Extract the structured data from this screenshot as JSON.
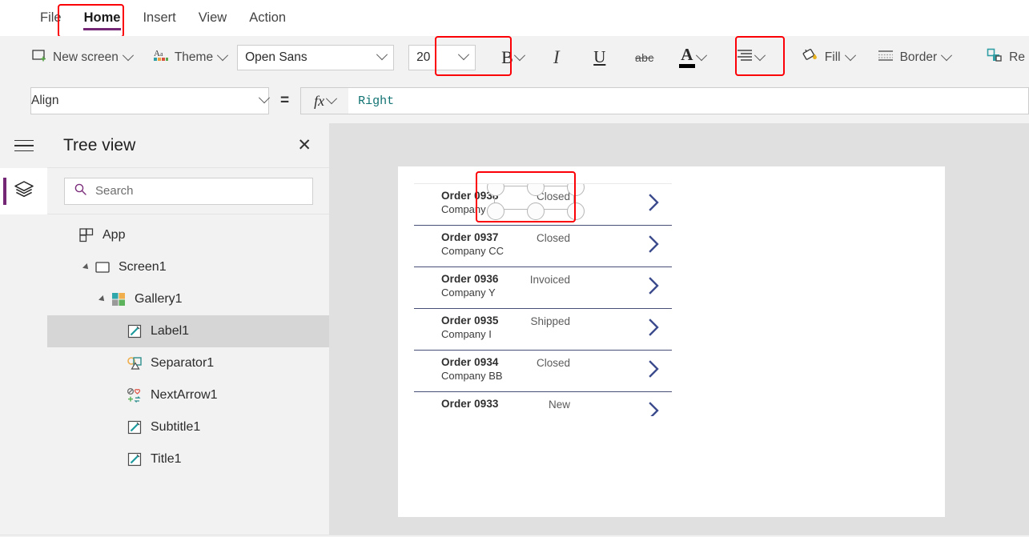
{
  "menubar": {
    "items": [
      {
        "label": "File",
        "active": false
      },
      {
        "label": "Home",
        "active": true
      },
      {
        "label": "Insert",
        "active": false
      },
      {
        "label": "View",
        "active": false
      },
      {
        "label": "Action",
        "active": false
      }
    ],
    "accent_color": "#742774"
  },
  "ribbon": {
    "new_screen_label": "New screen",
    "theme_label": "Theme",
    "font_family_value": "Open Sans",
    "font_size_value": "20",
    "bold_glyph": "B",
    "italic_glyph": "I",
    "underline_glyph": "U",
    "strikethrough_glyph": "abc",
    "font_color_glyph": "A",
    "align_label": "",
    "fill_label": "Fill",
    "border_label": "Border",
    "reorder_label": "Re",
    "highlight_color": "#fb0007"
  },
  "formula_bar": {
    "property_value": "Align",
    "equals": "=",
    "fx_glyph": "fx",
    "formula_value": "Right",
    "formula_color": "#117272"
  },
  "rail": {
    "menu_icon_name": "hamburger-icon",
    "items": [
      {
        "name": "tree-view",
        "icon": "layers-icon",
        "active": true
      }
    ]
  },
  "tree_panel": {
    "title": "Tree view",
    "close_label": "✕",
    "search_placeholder": "Search",
    "search_value": "",
    "items": [
      {
        "label": "App",
        "indent": 0,
        "icon": "app-icon",
        "arrow": false,
        "selected": false
      },
      {
        "label": "Screen1",
        "indent": 1,
        "icon": "screen-icon",
        "arrow": true,
        "selected": false
      },
      {
        "label": "Gallery1",
        "indent": 2,
        "icon": "gallery-icon",
        "arrow": true,
        "selected": false
      },
      {
        "label": "Label1",
        "indent": 3,
        "icon": "label-icon",
        "arrow": false,
        "selected": true
      },
      {
        "label": "Separator1",
        "indent": 3,
        "icon": "separator-icon",
        "arrow": false,
        "selected": false
      },
      {
        "label": "NextArrow1",
        "indent": 3,
        "icon": "nextarrow-icon",
        "arrow": false,
        "selected": false
      },
      {
        "label": "Subtitle1",
        "indent": 3,
        "icon": "label-icon",
        "arrow": false,
        "selected": false
      },
      {
        "label": "Title1",
        "indent": 3,
        "icon": "label-icon",
        "arrow": false,
        "selected": false
      }
    ]
  },
  "canvas": {
    "gallery": {
      "rows": [
        {
          "title": "Order 0938",
          "subtitle": "Company F",
          "status": "Closed",
          "selected": true
        },
        {
          "title": "Order 0937",
          "subtitle": "Company CC",
          "status": "Closed",
          "selected": false
        },
        {
          "title": "Order 0936",
          "subtitle": "Company Y",
          "status": "Invoiced",
          "selected": false
        },
        {
          "title": "Order 0935",
          "subtitle": "Company I",
          "status": "Shipped",
          "selected": false
        },
        {
          "title": "Order 0934",
          "subtitle": "Company BB",
          "status": "Closed",
          "selected": false
        },
        {
          "title": "Order 0933",
          "subtitle": "",
          "status": "New",
          "selected": false
        }
      ],
      "chevron_color": "#3b4a8c",
      "separator_color": "#484f77"
    }
  }
}
